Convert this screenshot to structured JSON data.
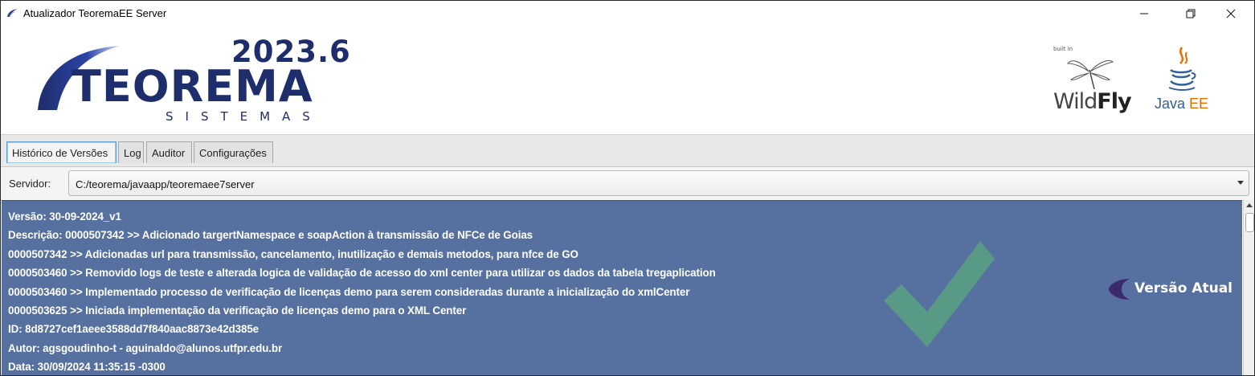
{
  "window": {
    "title": "Atualizador TeoremaEE Server"
  },
  "header": {
    "version": "2023.6",
    "brand": "TEOREMA",
    "brand_sub": "SISTEMAS",
    "wildfly_builtin": "built in",
    "wildfly_wild": "Wild",
    "wildfly_fly": "Fly",
    "javaee_java": "Java",
    "javaee_ee": " EE"
  },
  "tabs": [
    {
      "label": "Histórico de Versões",
      "active": true
    },
    {
      "label": "Log",
      "active": false
    },
    {
      "label": "Auditor",
      "active": false
    },
    {
      "label": "Configurações",
      "active": false
    }
  ],
  "server": {
    "label": "Servidor:",
    "value": "C:/teorema/javaapp/teoremaee7server"
  },
  "history": {
    "lines": [
      "Versão: 30-09-2024_v1",
      "Descrição: 0000507342 >> Adicionado targertNamespace e soapAction à transmissão de NFCe de Goias",
      "0000507342 >> Adicionadas url para transmissão, cancelamento, inutilização e demais metodos, para nfce de GO",
      "0000503460 >> Removido logs de teste e alterada logica de validação de acesso do xml center para utilizar os dados da tabela tregaplication",
      "0000503460 >> Implementado processo de verificação de licenças demo para serem consideradas durante a inicialização do xmlCenter",
      "0000503625 >> Iniciada implementação da verificação de licenças demo para o XML Center",
      "ID: 8d8727cef1aeee3588dd7f840aac8873e42d385e",
      "Autor: agsgoudinho-t - aguinaldo@alunos.utfpr.edu.br",
      "Data: 30/09/2024 11:35:15 -0300"
    ],
    "current_badge": "Versão Atual"
  },
  "colors": {
    "panel_bg": "#56709f",
    "brand_navy": "#1e2d6b",
    "checkmark": "#5a9e84",
    "badge_purple": "#3c2a6e"
  },
  "icons": {
    "app": "teorema-swoosh-icon",
    "minimize": "minimize-icon",
    "maximize": "restore-icon",
    "close": "close-icon",
    "dropdown": "chevron-down-icon",
    "check": "checkmark-icon",
    "badge": "version-badge-icon"
  }
}
